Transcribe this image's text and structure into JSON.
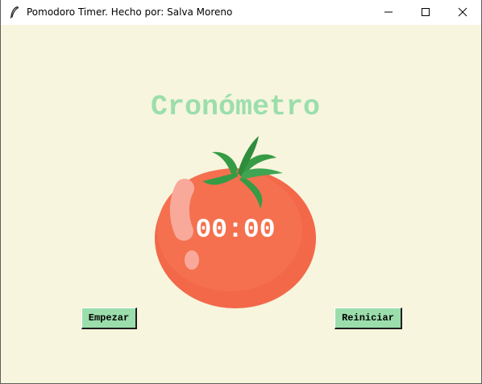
{
  "window": {
    "title": "Pomodoro Timer. Hecho por: Salva Moreno",
    "app_icon": "feather-icon",
    "controls": [
      "minimize-icon",
      "maximize-icon",
      "close-icon"
    ]
  },
  "main": {
    "heading": "Cronómetro",
    "timer": "00:00",
    "start_label": "Empezar",
    "reset_label": "Reiniciar"
  },
  "colors": {
    "background": "#f7f5dd",
    "accent_green": "#9bdeac",
    "tomato_red": "#f26849",
    "leaf_green": "#379b46"
  }
}
